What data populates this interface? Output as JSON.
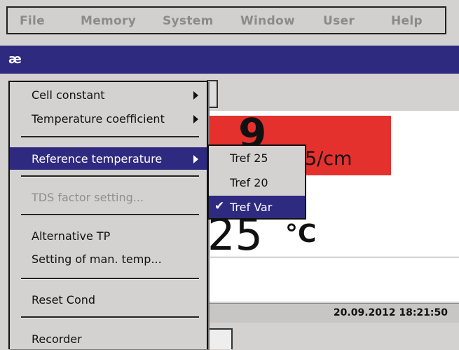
{
  "menubar": {
    "items": [
      "File",
      "Memory",
      "System",
      "Window",
      "User",
      "Help"
    ]
  },
  "titlebar": {
    "title": "æ"
  },
  "display": {
    "value_partial": "9",
    "unit_partial": "5/cm",
    "temperature_value": "25",
    "temperature_unit": "°C",
    "datetime": "20.09.2012 18:21:50"
  },
  "menu": {
    "items": [
      {
        "label": "Cell constant",
        "submenu": true
      },
      {
        "label": "Temperature coefficient",
        "submenu": true
      },
      {
        "label": "Reference temperature",
        "submenu": true,
        "highlighted": true
      },
      {
        "label": "TDS factor setting...",
        "disabled": true
      },
      {
        "label": "Alternative TP"
      },
      {
        "label": "Setting of man. temp..."
      },
      {
        "label": "Reset Cond"
      },
      {
        "label": "Recorder"
      }
    ]
  },
  "submenu": {
    "items": [
      {
        "label": "Tref 25"
      },
      {
        "label": "Tref 20"
      },
      {
        "label": "Tref Var",
        "selected": true
      }
    ]
  },
  "colors": {
    "title_bar": "#2e2a80",
    "highlight": "#2e2a80",
    "measurement_alarm": "#e4312e"
  }
}
